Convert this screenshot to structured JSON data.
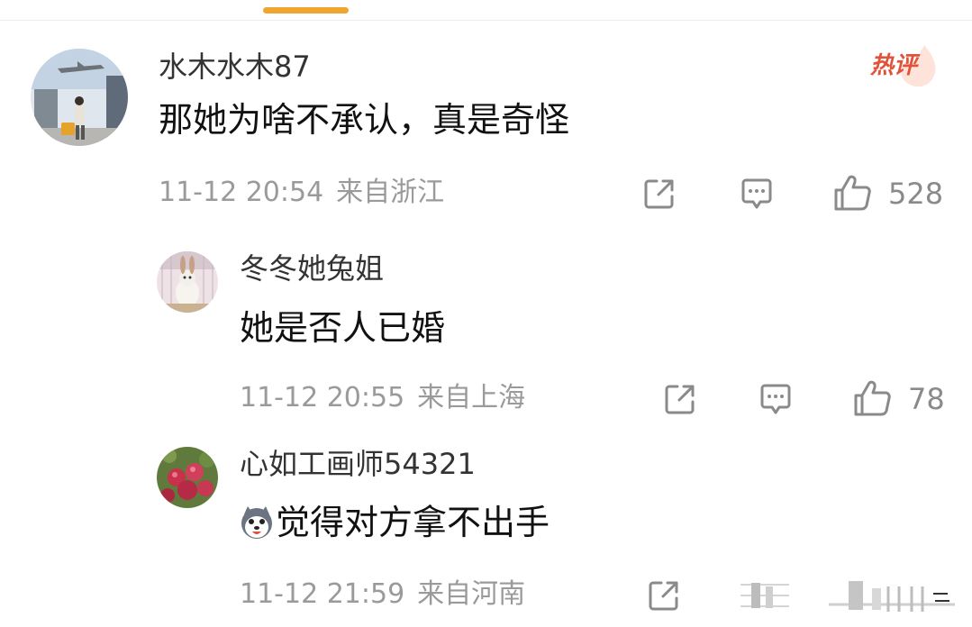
{
  "comments": [
    {
      "username": "水木水木87",
      "text": "那她为啥不承认，真是奇怪",
      "time": "11-12 20:54",
      "location": "来自浙江",
      "likes": "528",
      "badge": "热评"
    },
    {
      "username": "冬冬她兔姐",
      "text": "她是否人已婚",
      "time": "11-12 20:55",
      "location": "来自上海",
      "likes": "78"
    },
    {
      "username": "心如工画师54321",
      "text": "觉得对方拿不出手",
      "time": "11-12 21:59",
      "location": "来自河南",
      "likes": ""
    }
  ],
  "icons": {
    "share": "share-icon",
    "comment": "comment-icon",
    "like": "thumbs-up-icon",
    "hot": "flame-icon",
    "emoji": "husky-emoji-icon"
  },
  "colors": {
    "accent": "#f0a530",
    "hot": "#e0533a",
    "meta": "#9a9a9a"
  }
}
